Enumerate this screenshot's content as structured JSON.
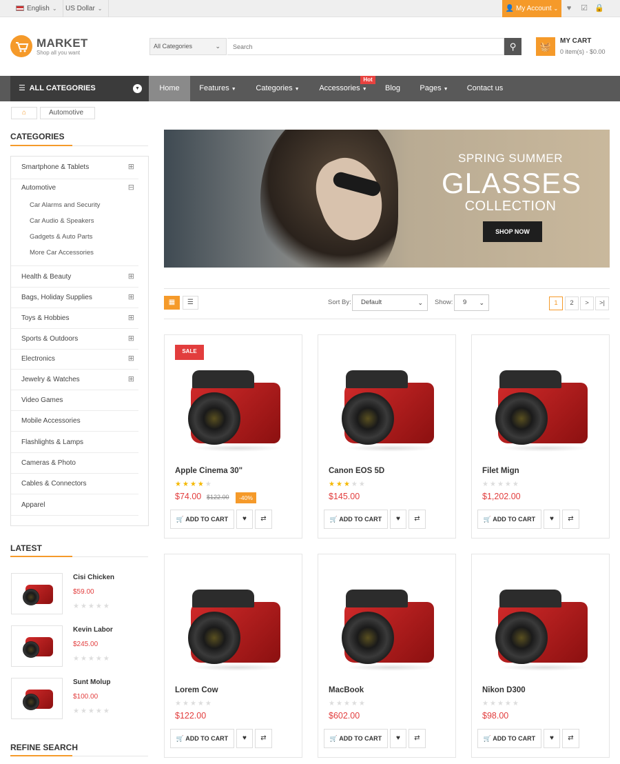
{
  "topbar": {
    "language": "English",
    "currency": "US Dollar",
    "account": "My Account",
    "icons": [
      "heart-icon",
      "checklist-icon",
      "lock-icon"
    ]
  },
  "header": {
    "logo_title": "MARKET",
    "logo_tagline": "Shop all you want",
    "category_select": "All Categories",
    "search_placeholder": "Search",
    "cart_title": "MY CART",
    "cart_summary": "0 item(s) - $0.00"
  },
  "nav": {
    "all_categories": "ALL CATEGORIES",
    "items": [
      {
        "label": "Home"
      },
      {
        "label": "Features"
      },
      {
        "label": "Categories"
      },
      {
        "label": "Accessories"
      },
      {
        "label": "Blog"
      },
      {
        "label": "Pages"
      },
      {
        "label": "Contact us"
      }
    ],
    "hot_badge": "Hot"
  },
  "breadcrumb": {
    "current": "Automotive"
  },
  "sidebar": {
    "categories_title": "CATEGORIES",
    "categories": [
      {
        "label": "Smartphone & Tablets"
      },
      {
        "label": "Automotive"
      },
      {
        "label": "Health & Beauty"
      },
      {
        "label": "Bags, Holiday Supplies"
      },
      {
        "label": "Toys & Hobbies"
      },
      {
        "label": "Sports & Outdoors"
      },
      {
        "label": "Electronics"
      },
      {
        "label": "Jewelry & Watches"
      },
      {
        "label": "Video Games"
      },
      {
        "label": "Mobile Accessories"
      },
      {
        "label": "Flashlights & Lamps"
      },
      {
        "label": "Cameras & Photo"
      },
      {
        "label": "Cables & Connectors"
      },
      {
        "label": "Apparel"
      }
    ],
    "subcategories": [
      "Car Alarms and Security",
      "Car Audio & Speakers",
      "Gadgets & Auto Parts",
      "More Car Accessories"
    ],
    "latest_title": "LATEST",
    "latest": [
      {
        "name": "Cisi Chicken",
        "price": "$59.00",
        "rating": 0
      },
      {
        "name": "Kevin Labor",
        "price": "$245.00",
        "rating": 0
      },
      {
        "name": "Sunt Molup",
        "price": "$100.00",
        "rating": 0
      }
    ],
    "refine_title": "REFINE SEARCH"
  },
  "banner": {
    "line1": "SPRING SUMMER",
    "line2": "GLASSES",
    "line3": "COLLECTION",
    "button": "SHOP NOW"
  },
  "toolbar": {
    "sort_label": "Sort By:",
    "sort_value": "Default",
    "show_label": "Show:",
    "show_value": "9",
    "pages": [
      "1",
      "2",
      ">",
      ">|"
    ]
  },
  "products": [
    {
      "name": "Apple Cinema 30\"",
      "rating": 4,
      "price": "$74.00",
      "old_price": "$122.00",
      "discount": "-40%",
      "sale": "SALE"
    },
    {
      "name": "Canon EOS 5D",
      "rating": 3,
      "price": "$145.00"
    },
    {
      "name": "Filet Mign",
      "rating": 0,
      "price": "$1,202.00"
    },
    {
      "name": "Lorem Cow",
      "rating": 0,
      "price": "$122.00"
    },
    {
      "name": "MacBook",
      "rating": 0,
      "price": "$602.00"
    },
    {
      "name": "Nikon D300",
      "rating": 0,
      "price": "$98.00"
    }
  ],
  "card_buttons": {
    "add_to_cart": "ADD TO CART"
  },
  "colors": {
    "accent": "#f59a2a",
    "price": "#e23d3d",
    "nav": "#595959",
    "nav_dark": "#3b3b3b"
  }
}
